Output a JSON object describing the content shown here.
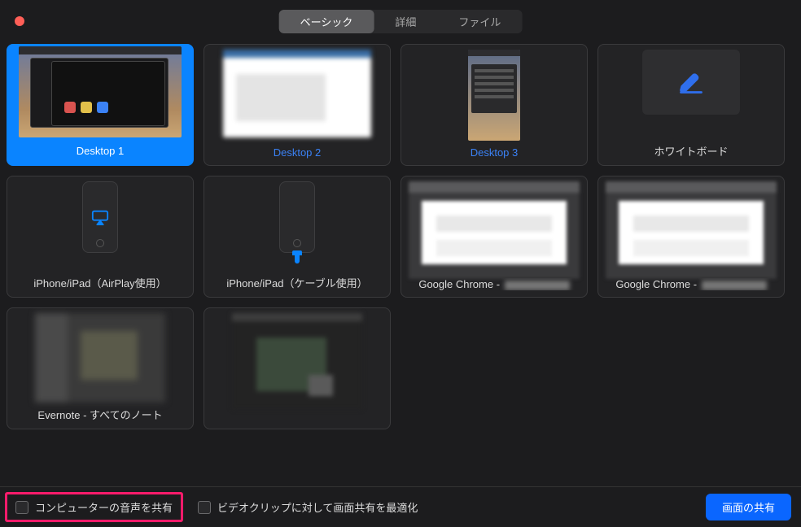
{
  "tabs": [
    "ベーシック",
    "詳細",
    "ファイル"
  ],
  "active_tab": 0,
  "selected_source": 0,
  "sources": [
    {
      "id": "desktop-1",
      "label": "Desktop 1"
    },
    {
      "id": "desktop-2",
      "label": "Desktop 2"
    },
    {
      "id": "desktop-3",
      "label": "Desktop 3"
    },
    {
      "id": "whiteboard",
      "label": "ホワイトボード"
    },
    {
      "id": "iphone-airplay",
      "label": "iPhone/iPad（AirPlay使用）"
    },
    {
      "id": "iphone-cable",
      "label": "iPhone/iPad（ケーブル使用）"
    },
    {
      "id": "chrome-1",
      "label": "Google Chrome - "
    },
    {
      "id": "chrome-2",
      "label": "Google Chrome - "
    },
    {
      "id": "evernote",
      "label": "Evernote - すべてのノート"
    },
    {
      "id": "untitled",
      "label": ""
    }
  ],
  "footer": {
    "share_sound": "コンピューターの音声を共有",
    "share_sound_checked": false,
    "share_sound_highlighted": true,
    "optimize_video": "ビデオクリップに対して画面共有を最適化",
    "optimize_video_checked": false,
    "share_button": "画面の共有"
  },
  "colors": {
    "accent": "#0a84ff",
    "highlight_border": "#ff1b6b",
    "link": "#3b82f6"
  }
}
